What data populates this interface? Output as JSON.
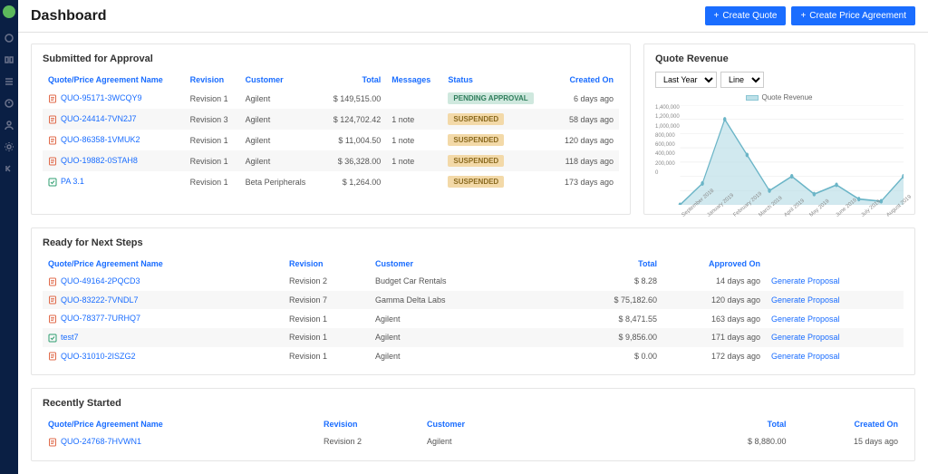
{
  "header": {
    "title": "Dashboard",
    "create_quote": "Create Quote",
    "create_price_agreement": "Create Price Agreement"
  },
  "approval": {
    "title": "Submitted for Approval",
    "cols": {
      "name": "Quote/Price Agreement Name",
      "revision": "Revision",
      "customer": "Customer",
      "total": "Total",
      "messages": "Messages",
      "status": "Status",
      "created": "Created On"
    },
    "rows": [
      {
        "icon": "quote",
        "name": "QUO-95171-3WCQY9",
        "revision": "Revision 1",
        "customer": "Agilent",
        "total": "$ 149,515.00",
        "messages": "",
        "status": "PENDING APPROVAL",
        "status_cls": "pending",
        "created": "6 days ago"
      },
      {
        "icon": "quote",
        "name": "QUO-24414-7VN2J7",
        "revision": "Revision 3",
        "customer": "Agilent",
        "total": "$ 124,702.42",
        "messages": "1 note",
        "status": "SUSPENDED",
        "status_cls": "suspended",
        "created": "58 days ago"
      },
      {
        "icon": "quote",
        "name": "QUO-86358-1VMUK2",
        "revision": "Revision 1",
        "customer": "Agilent",
        "total": "$ 11,004.50",
        "messages": "1 note",
        "status": "SUSPENDED",
        "status_cls": "suspended",
        "created": "120 days ago"
      },
      {
        "icon": "quote",
        "name": "QUO-19882-0STAH8",
        "revision": "Revision 1",
        "customer": "Agilent",
        "total": "$ 36,328.00",
        "messages": "1 note",
        "status": "SUSPENDED",
        "status_cls": "suspended",
        "created": "118 days ago"
      },
      {
        "icon": "pa",
        "name": "PA 3.1",
        "revision": "Revision 1",
        "customer": "Beta Peripherals",
        "total": "$ 1,264.00",
        "messages": "",
        "status": "SUSPENDED",
        "status_cls": "suspended",
        "created": "173 days ago"
      }
    ]
  },
  "revenue": {
    "title": "Quote Revenue",
    "period": "Last Year",
    "chart_type": "Line",
    "legend": "Quote Revenue"
  },
  "chart_data": {
    "type": "area",
    "title": "Quote Revenue",
    "xlabel": "",
    "ylabel": "",
    "ylim": [
      0,
      1400000
    ],
    "categories": [
      "September 2018",
      "January 2019",
      "February 2019",
      "March 2019",
      "April 2019",
      "May 2019",
      "June 2019",
      "July 2019",
      "August 2019"
    ],
    "series": [
      {
        "name": "Quote Revenue",
        "values": [
          0,
          300000,
          1200000,
          700000,
          200000,
          400000,
          150000,
          280000,
          80000,
          50000,
          400000
        ]
      }
    ],
    "y_ticks": [
      1400000,
      1200000,
      1000000,
      800000,
      600000,
      400000,
      200000,
      0
    ]
  },
  "next_steps": {
    "title": "Ready for Next Steps",
    "cols": {
      "name": "Quote/Price Agreement Name",
      "revision": "Revision",
      "customer": "Customer",
      "total": "Total",
      "approved": "Approved On",
      "action": ""
    },
    "action_label": "Generate Proposal",
    "rows": [
      {
        "icon": "quote",
        "name": "QUO-49164-2PQCD3",
        "revision": "Revision 2",
        "customer": "Budget Car Rentals",
        "total": "$ 8.28",
        "approved": "14 days ago"
      },
      {
        "icon": "quote",
        "name": "QUO-83222-7VNDL7",
        "revision": "Revision 7",
        "customer": "Gamma Delta Labs",
        "total": "$ 75,182.60",
        "approved": "120 days ago"
      },
      {
        "icon": "quote",
        "name": "QUO-78377-7URHQ7",
        "revision": "Revision 1",
        "customer": "Agilent",
        "total": "$ 8,471.55",
        "approved": "163 days ago"
      },
      {
        "icon": "pa",
        "name": "test7",
        "revision": "Revision 1",
        "customer": "Agilent",
        "total": "$ 9,856.00",
        "approved": "171 days ago"
      },
      {
        "icon": "quote",
        "name": "QUO-31010-2ISZG2",
        "revision": "Revision 1",
        "customer": "Agilent",
        "total": "$ 0.00",
        "approved": "172 days ago"
      }
    ]
  },
  "recent": {
    "title": "Recently Started",
    "cols": {
      "name": "Quote/Price Agreement Name",
      "revision": "Revision",
      "customer": "Customer",
      "total": "Total",
      "created": "Created On"
    },
    "rows": [
      {
        "icon": "quote",
        "name": "QUO-24768-7HVWN1",
        "revision": "Revision 2",
        "customer": "Agilent",
        "total": "$ 8,880.00",
        "created": "15 days ago"
      }
    ]
  }
}
